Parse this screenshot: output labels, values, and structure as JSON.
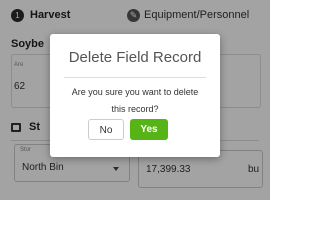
{
  "stepper": {
    "step1": {
      "number": "1",
      "label": "Harvest"
    },
    "step2": {
      "icon_glyph": "✎",
      "label": "Equipment/Personnel"
    }
  },
  "background": {
    "section_title": "Soybe",
    "field_label": "Are",
    "field_value": "62",
    "storage": {
      "title": "St",
      "select_label": "Stor",
      "select_value": "North Bin",
      "amount_value": "17,399.33",
      "amount_unit": "bu"
    }
  },
  "dialog": {
    "title": "Delete Field Record",
    "message": "Are you sure you want to delete this record?",
    "no_label": "No",
    "yes_label": "Yes"
  },
  "colors": {
    "accent_green": "#56b417",
    "overlay": "rgba(0,0,0,0.36)"
  }
}
